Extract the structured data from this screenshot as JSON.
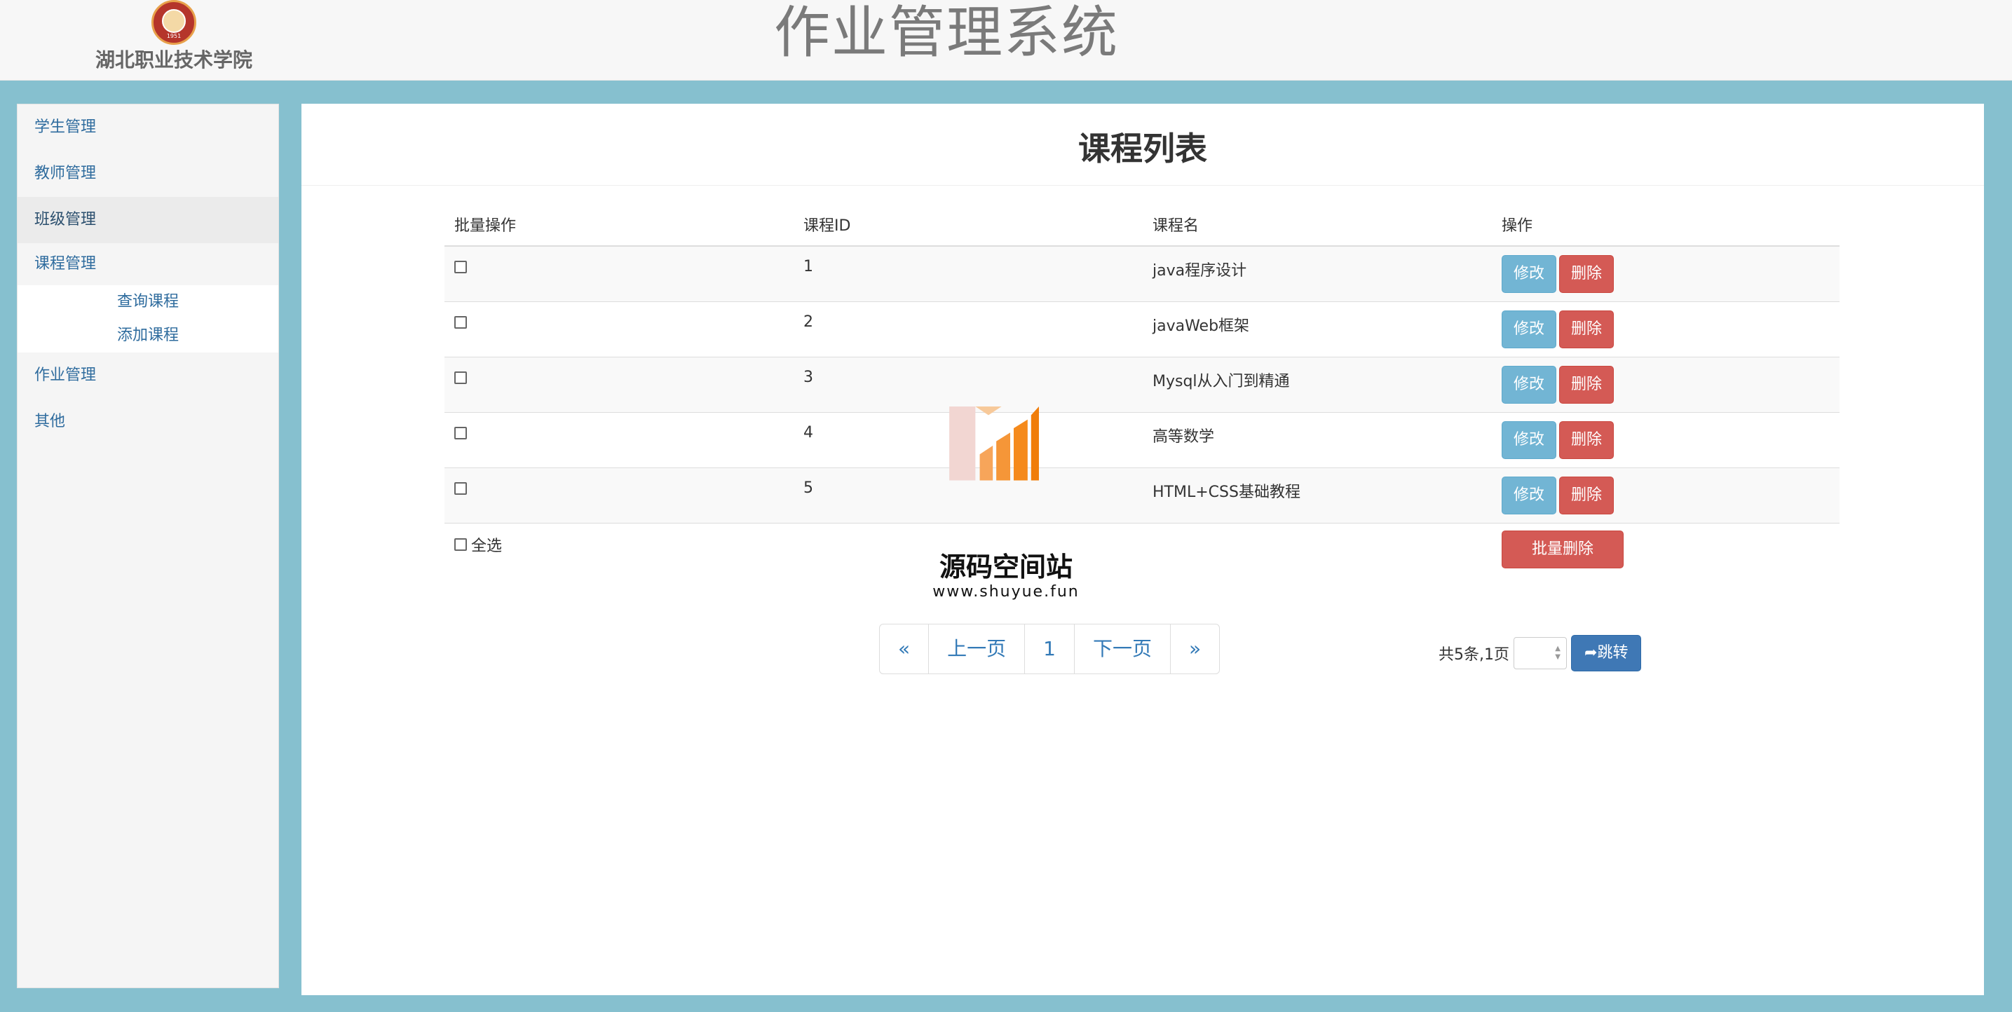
{
  "header": {
    "school_name": "湖北职业技术学院",
    "logo_year": "1951",
    "title": "作业管理系统"
  },
  "sidebar": {
    "items": [
      {
        "label": "学生管理"
      },
      {
        "label": "教师管理"
      },
      {
        "label": "班级管理"
      },
      {
        "label": "课程管理",
        "children": [
          {
            "label": "查询课程"
          },
          {
            "label": "添加课程"
          }
        ]
      },
      {
        "label": "作业管理"
      },
      {
        "label": "其他"
      }
    ]
  },
  "main": {
    "title": "课程列表",
    "table": {
      "headers": [
        "批量操作",
        "课程ID",
        "课程名",
        "操作"
      ],
      "rows": [
        {
          "id": "1",
          "name": "java程序设计"
        },
        {
          "id": "2",
          "name": "javaWeb框架"
        },
        {
          "id": "3",
          "name": "Mysql从入门到精通"
        },
        {
          "id": "4",
          "name": "高等数学"
        },
        {
          "id": "5",
          "name": "HTML+CSS基础教程"
        }
      ],
      "edit_label": "修改",
      "delete_label": "删除"
    },
    "select_all_label": "全选",
    "batch_delete_label": "批量删除",
    "pagination": {
      "first": "«",
      "prev": "上一页",
      "current": "1",
      "next": "下一页",
      "last": "»"
    },
    "page_info": "共5条,1页",
    "jump_label": "跳转"
  },
  "watermark": {
    "title": "源码空间站",
    "url": "www.shuyue.fun"
  },
  "colors": {
    "background": "#86c0cf",
    "link": "#337ab7",
    "info_button": "#72b5d4",
    "danger_button": "#d45a55",
    "jump_button": "#3f78b5"
  }
}
